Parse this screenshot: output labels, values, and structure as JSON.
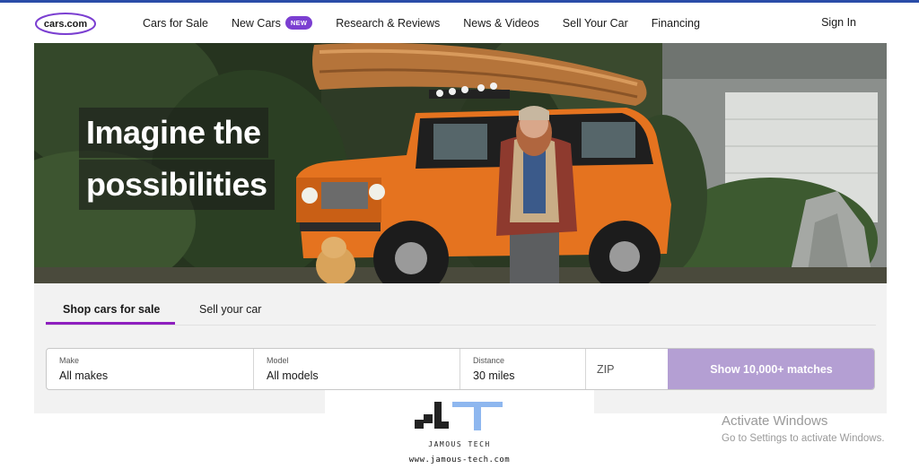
{
  "header": {
    "logo_text": "cars.com",
    "nav": [
      {
        "label": "Cars for Sale"
      },
      {
        "label": "New Cars",
        "badge": "NEW"
      },
      {
        "label": "Research & Reviews"
      },
      {
        "label": "News & Videos"
      },
      {
        "label": "Sell Your Car"
      },
      {
        "label": "Financing"
      }
    ],
    "sign_in": "Sign In"
  },
  "hero": {
    "headline_line1": "Imagine the",
    "headline_line2": "possibilities"
  },
  "search": {
    "tabs": [
      {
        "label": "Shop cars for sale",
        "active": true
      },
      {
        "label": "Sell your car",
        "active": false
      }
    ],
    "fields": {
      "make": {
        "label": "Make",
        "value": "All makes"
      },
      "model": {
        "label": "Model",
        "value": "All models"
      },
      "distance": {
        "label": "Distance",
        "value": "30 miles"
      },
      "zip": {
        "placeholder": "ZIP",
        "value": ""
      }
    },
    "submit_label": "Show 10,000+ matches"
  },
  "watermark": {
    "title": "JAMOUS TECH",
    "url": "www.jamous-tech.com"
  },
  "os_notice": {
    "title": "Activate Windows",
    "subtitle": "Go to Settings to activate Windows."
  },
  "colors": {
    "brand_purple": "#8e1fbf",
    "badge_purple": "#7b3fd1",
    "button_disabled": "#b49fd3",
    "top_border": "#2a4da8",
    "panel_bg": "#f2f2f2"
  }
}
